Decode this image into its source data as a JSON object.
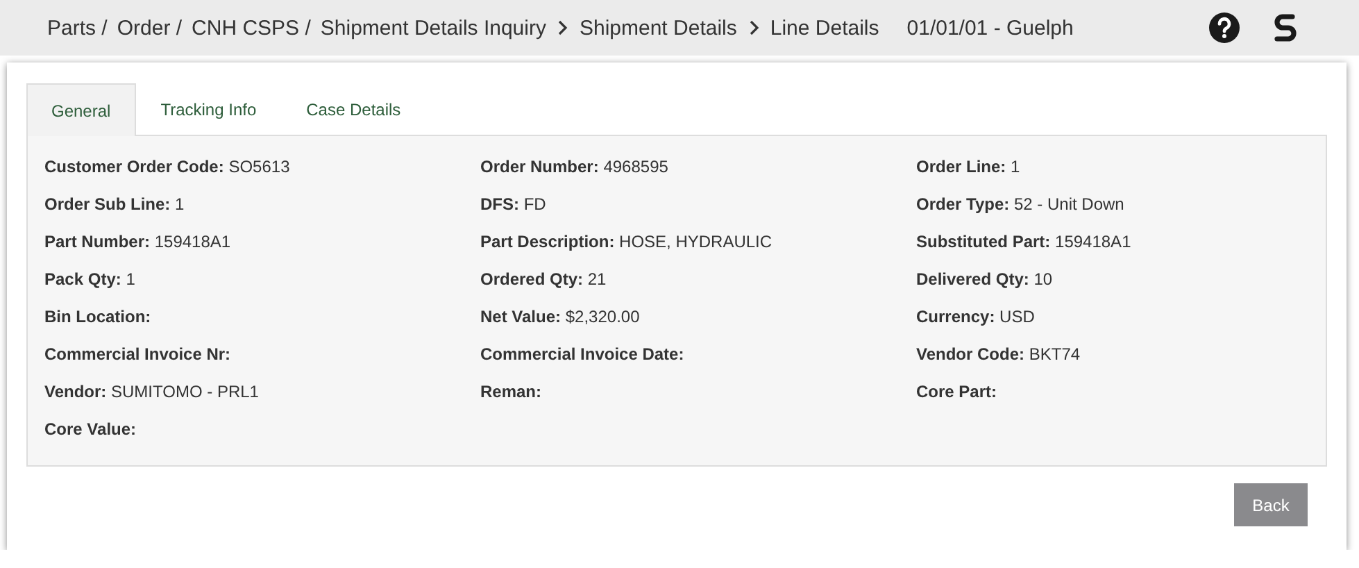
{
  "breadcrumb": [
    {
      "label": "Parts /",
      "kind": "plain"
    },
    {
      "label": "Order /",
      "kind": "plain"
    },
    {
      "label": "CNH CSPS /",
      "kind": "plain"
    },
    {
      "label": "Shipment Details Inquiry",
      "kind": "chevron"
    },
    {
      "label": "Shipment Details",
      "kind": "chevron"
    },
    {
      "label": "Line Details",
      "kind": "plain"
    }
  ],
  "location": "01/01/01 - Guelph",
  "tabs": [
    {
      "label": "General",
      "selected": true
    },
    {
      "label": "Tracking Info",
      "selected": false
    },
    {
      "label": "Case Details",
      "selected": false
    }
  ],
  "fields": [
    {
      "label": "Customer Order Code:",
      "value": "SO5613"
    },
    {
      "label": "Order Number:",
      "value": "4968595"
    },
    {
      "label": "Order Line:",
      "value": "1"
    },
    {
      "label": "Order Sub Line:",
      "value": "1"
    },
    {
      "label": "DFS:",
      "value": "FD"
    },
    {
      "label": "Order Type:",
      "value": "52 - Unit Down"
    },
    {
      "label": "Part Number:",
      "value": "159418A1"
    },
    {
      "label": "Part Description:",
      "value": "HOSE, HYDRAULIC"
    },
    {
      "label": "Substituted Part:",
      "value": "159418A1"
    },
    {
      "label": "Pack Qty:",
      "value": "1"
    },
    {
      "label": "Ordered Qty:",
      "value": "21"
    },
    {
      "label": "Delivered Qty:",
      "value": "10"
    },
    {
      "label": "Bin Location:"
    },
    {
      "label": "Net Value:",
      "value": "$2,320.00"
    },
    {
      "label": "Currency:",
      "value": "USD"
    },
    {
      "label": "Commercial Invoice Nr:"
    },
    {
      "label": "Commercial Invoice Date:"
    },
    {
      "label": "Vendor Code:",
      "value": "BKT74"
    },
    {
      "label": "Vendor:",
      "value": "SUMITOMO - PRL1"
    },
    {
      "label": "Reman:"
    },
    {
      "label": "Core Part:"
    },
    {
      "label": "Core Value:"
    }
  ],
  "back_button": "Back"
}
